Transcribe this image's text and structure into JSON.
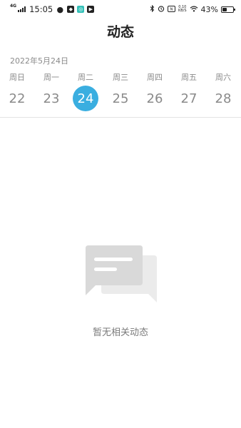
{
  "status_bar": {
    "network": "4G",
    "time": "15:05",
    "speed_top": "0.10",
    "speed_bottom": "KB/S",
    "battery_pct": "43%",
    "battery_level": 0.43
  },
  "header": {
    "title": "动态"
  },
  "calendar": {
    "date_label": "2022年5月24日",
    "weekdays": [
      "周日",
      "周一",
      "周二",
      "周三",
      "周四",
      "周五",
      "周六"
    ],
    "days": [
      "22",
      "23",
      "24",
      "25",
      "26",
      "27",
      "28"
    ],
    "selected_index": 2,
    "accent_color": "#3aaee0"
  },
  "empty_state": {
    "icon": "chat-bubbles-icon",
    "message": "暂无相关动态"
  }
}
